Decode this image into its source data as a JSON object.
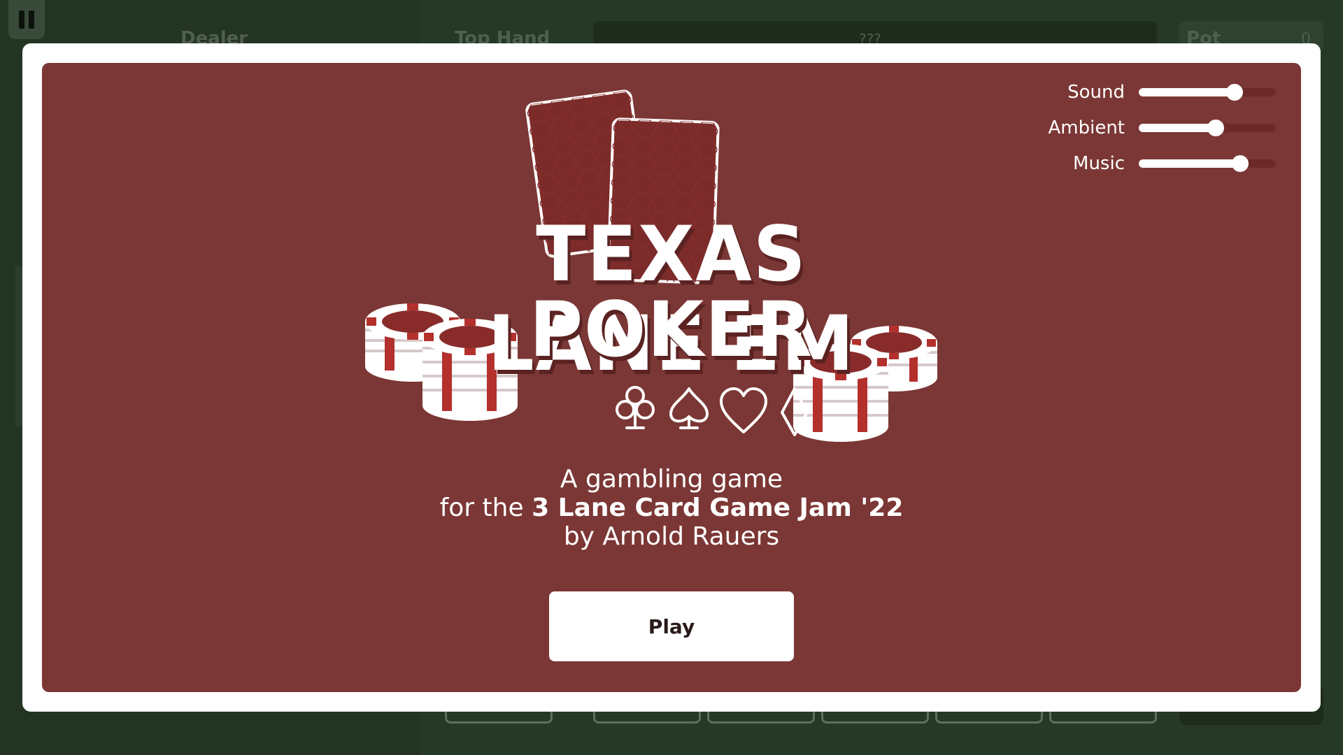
{
  "background": {
    "dealer_label": "Dealer",
    "top_hand_label": "Top Hand",
    "top_hand_value": "???",
    "pot_label": "Pot",
    "pot_value": "0"
  },
  "pause_button": {
    "icon": "pause-icon"
  },
  "settings": {
    "sound": {
      "label": "Sound",
      "value": 0.7
    },
    "ambient": {
      "label": "Ambient",
      "value": 0.56
    },
    "music": {
      "label": "Music",
      "value": 0.74
    }
  },
  "logo": {
    "title_line1": "TEXAS LANE'EM",
    "title_line2": "POKER",
    "suits": [
      "club-icon",
      "spade-icon",
      "heart-icon",
      "diamond-icon"
    ]
  },
  "subtitle": {
    "line1": "A gambling game",
    "line2_prefix": "for the ",
    "line2_bold": "3 Lane Card Game Jam '22",
    "line3": "by Arnold Rauers"
  },
  "play_button": {
    "label": "Play"
  },
  "colors": {
    "table_green": "#263826",
    "panel_red": "#7b3735",
    "chip_red": "#8a2b2b",
    "white": "#ffffff"
  }
}
